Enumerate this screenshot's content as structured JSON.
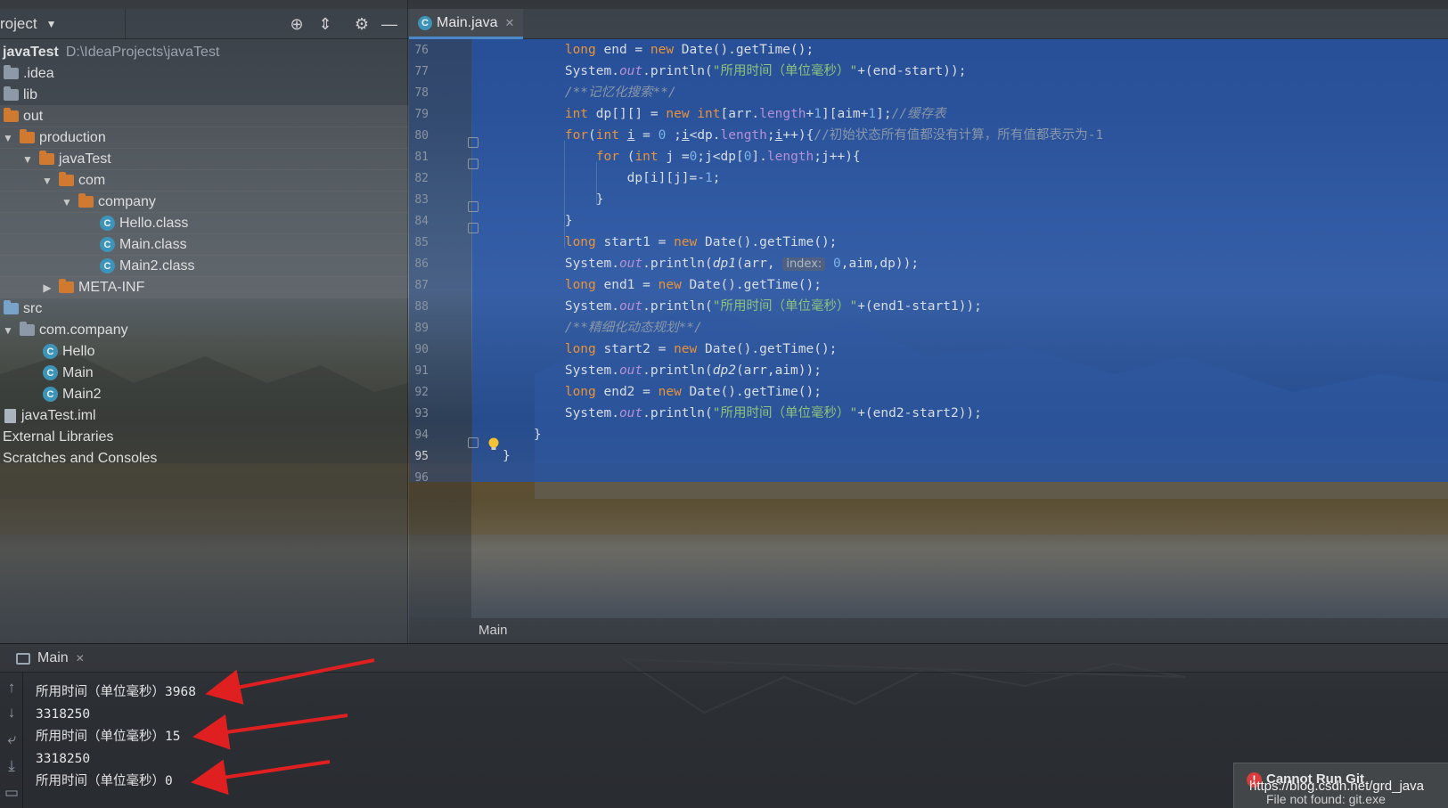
{
  "project_panel": {
    "title": "roject",
    "tools": [
      "crosshair-icon",
      "collapse-icon",
      "gear-icon",
      "minimize-icon"
    ],
    "root": {
      "name": "javaTest",
      "path": "D:\\IdeaProjects\\javaTest"
    },
    "items": [
      {
        "label": ".idea"
      },
      {
        "label": "lib"
      },
      {
        "label": "out"
      },
      {
        "label": "production"
      },
      {
        "label": "javaTest"
      },
      {
        "label": "com"
      },
      {
        "label": "company"
      },
      {
        "label": "Hello.class"
      },
      {
        "label": "Main.class"
      },
      {
        "label": "Main2.class"
      },
      {
        "label": "META-INF"
      },
      {
        "label": "src"
      },
      {
        "label": "com.company"
      },
      {
        "label": "Hello"
      },
      {
        "label": "Main"
      },
      {
        "label": "Main2"
      },
      {
        "label": "javaTest.iml"
      },
      {
        "label": "External Libraries"
      },
      {
        "label": "Scratches and Consoles"
      }
    ]
  },
  "editor": {
    "tab": {
      "label": "Main.java"
    },
    "line_numbers": [
      "76",
      "77",
      "78",
      "79",
      "80",
      "81",
      "82",
      "83",
      "84",
      "85",
      "86",
      "87",
      "88",
      "89",
      "90",
      "91",
      "92",
      "93",
      "94",
      "95",
      "96"
    ],
    "breadcrumb": "Main",
    "hint_label": "index:"
  },
  "run_panel": {
    "tab": {
      "label": "Main"
    },
    "output": [
      "所用时间（单位毫秒）3968",
      "3318250",
      "所用时间（单位毫秒）15",
      "3318250",
      "所用时间（单位毫秒）0"
    ]
  },
  "notification": {
    "title": "Cannot Run Git",
    "body": "File not found: git.exe"
  },
  "watermark": "https://blog.csdn.net/grd_java",
  "colors": {
    "selection": "#2152aa",
    "keyword": "#e8933b",
    "string": "#8fc27a",
    "annotation_arrow": "#e02020",
    "error": "#d93c3c"
  }
}
